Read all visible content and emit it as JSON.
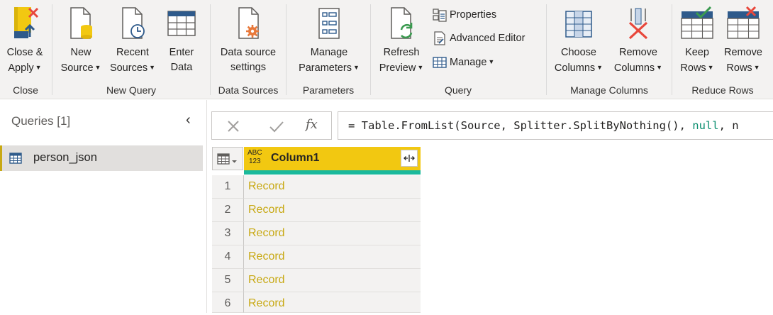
{
  "ribbon": {
    "close": {
      "close_apply_line1": "Close &",
      "close_apply_line2": "Apply",
      "group_label": "Close"
    },
    "new_query": {
      "new_source_line1": "New",
      "new_source_line2": "Source",
      "recent_sources_line1": "Recent",
      "recent_sources_line2": "Sources",
      "enter_data_line1": "Enter",
      "enter_data_line2": "Data",
      "group_label": "New Query"
    },
    "data_sources": {
      "settings_line1": "Data source",
      "settings_line2": "settings",
      "group_label": "Data Sources"
    },
    "parameters": {
      "manage_line1": "Manage",
      "manage_line2": "Parameters",
      "group_label": "Parameters"
    },
    "query": {
      "refresh_line1": "Refresh",
      "refresh_line2": "Preview",
      "properties": "Properties",
      "advanced_editor": "Advanced Editor",
      "manage": "Manage",
      "group_label": "Query"
    },
    "manage_columns": {
      "choose_line1": "Choose",
      "choose_line2": "Columns",
      "remove_line1": "Remove",
      "remove_line2": "Columns",
      "group_label": "Manage Columns"
    },
    "reduce_rows": {
      "keep_line1": "Keep",
      "keep_line2": "Rows",
      "remove_line1": "Remove",
      "remove_line2": "Rows",
      "group_label": "Reduce Rows"
    }
  },
  "queries_pane": {
    "title": "Queries [1]",
    "items": [
      {
        "label": "person_json"
      }
    ]
  },
  "formula_bar": {
    "fx": "fx",
    "text_prefix": "= Table.FromList(Source, Splitter.SplitByNothing(), ",
    "text_null": "null",
    "text_suffix": ", n"
  },
  "grid": {
    "column_type_line1": "ABC",
    "column_type_line2": "123",
    "column_name": "Column1",
    "rows": [
      {
        "num": "1",
        "value": "Record"
      },
      {
        "num": "2",
        "value": "Record"
      },
      {
        "num": "3",
        "value": "Record"
      },
      {
        "num": "4",
        "value": "Record"
      },
      {
        "num": "5",
        "value": "Record"
      },
      {
        "num": "6",
        "value": "Record"
      }
    ]
  },
  "colors": {
    "accent_yellow": "#f2c811",
    "record_text": "#c8a914",
    "quality_bar": "#1ab99c",
    "remove_red": "#e8473b",
    "refresh_green": "#3a9a4f",
    "icon_blue": "#2e5a8b"
  }
}
